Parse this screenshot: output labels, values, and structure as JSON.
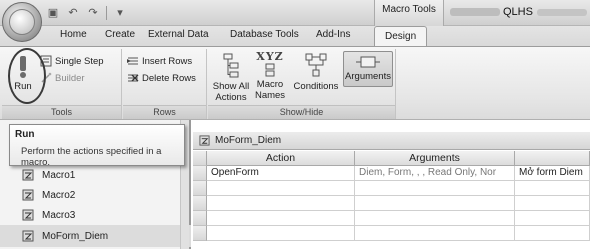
{
  "titlebar": {
    "context_tab": "Macro Tools",
    "app_title": "QLHS"
  },
  "tabs": [
    "Home",
    "Create",
    "External Data",
    "Database Tools",
    "Add-Ins",
    "Design"
  ],
  "ribbon": {
    "tools": {
      "label": "Tools",
      "run": "Run",
      "single_step": "Single Step",
      "builder": "Builder"
    },
    "rows": {
      "label": "Rows",
      "insert_rows": "Insert Rows",
      "delete_rows": "Delete Rows"
    },
    "show_hide": {
      "label": "Show/Hide",
      "show_all_actions_1": "Show All",
      "show_all_actions_2": "Actions",
      "macro_names_icon_text": "XYZ",
      "macro_names_1": "Macro",
      "macro_names_2": "Names",
      "conditions": "Conditions",
      "arguments": "Arguments"
    }
  },
  "tooltip": {
    "title": "Run",
    "body": "Perform the actions specified in a macro."
  },
  "nav": {
    "items": [
      {
        "label": "Macro1"
      },
      {
        "label": "Macro2"
      },
      {
        "label": "Macro3"
      },
      {
        "label": "MoForm_Diem"
      }
    ]
  },
  "document": {
    "tab_label": "MoForm_Diem",
    "columns": [
      "Action",
      "Arguments"
    ],
    "rows": [
      {
        "action": "OpenForm",
        "arguments": "Diem, Form, , , Read Only, Nor",
        "comment": "Mở form Diem"
      }
    ]
  }
}
